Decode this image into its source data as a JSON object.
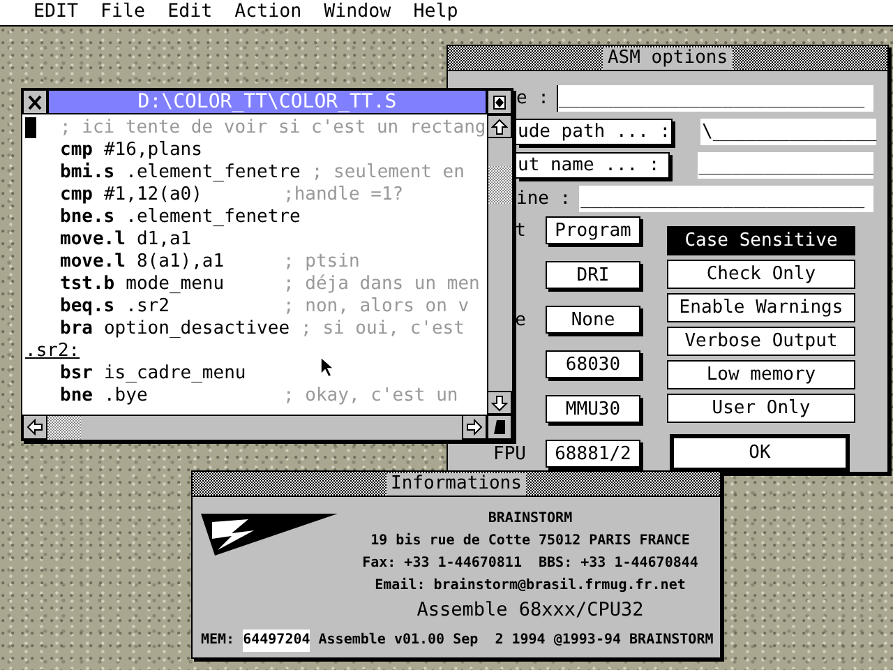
{
  "menu_bar": {
    "items": [
      "EDIT",
      "File",
      "Edit",
      "Action",
      "Window",
      "Help"
    ]
  },
  "asm_options": {
    "title": "ASM options",
    "fields": [
      {
        "kind": "label",
        "label": "e :",
        "value": "____________________________",
        "focused": true
      },
      {
        "kind": "button",
        "label": "ude path ... :",
        "value": "\\_______________",
        "focused": false
      },
      {
        "kind": "button",
        "label": "ut name ... :",
        "value": "________________",
        "focused": false
      },
      {
        "kind": "label",
        "label": "ine :",
        "value": "__________________________",
        "focused": false
      }
    ],
    "choices": [
      {
        "label": "t",
        "value": "Program"
      },
      {
        "value": "DRI"
      },
      {
        "label": "e",
        "value": "None"
      },
      {
        "value": "68030"
      },
      {
        "value": "MMU30"
      },
      {
        "label": "FPU",
        "value": "68881/2"
      }
    ],
    "toggles": [
      {
        "label": "Case Sensitive",
        "selected": true
      },
      {
        "label": "Check Only",
        "selected": false
      },
      {
        "label": "Enable Warnings",
        "selected": false
      },
      {
        "label": "Verbose Output",
        "selected": false
      },
      {
        "label": "Low memory",
        "selected": false
      },
      {
        "label": "User Only",
        "selected": false
      }
    ],
    "ok_button": "OK"
  },
  "editor_window": {
    "title": "D:\\COLOR_TT\\COLOR_TT.S",
    "lines": [
      {
        "kind": "comment",
        "text": "; ici tente de voir si c'est un rectang",
        "cursor": true
      },
      {
        "kind": "instruction",
        "mnemonic": "cmp",
        "operands": "#16,plans",
        "cursor": false
      },
      {
        "kind": "instruction",
        "mnemonic": "bmi.s",
        "operands": ".element_fenetre",
        "comment": "; seulement en",
        "cursor": false
      },
      {
        "kind": "instruction",
        "mnemonic": "cmp",
        "operands": "#1,12(a0)",
        "comment": ";handle =1?",
        "cursor": false
      },
      {
        "kind": "instruction",
        "mnemonic": "bne.s",
        "operands": ".element_fenetre",
        "cursor": false
      },
      {
        "kind": "instruction",
        "mnemonic": "move.l",
        "operands": "d1,a1",
        "cursor": false
      },
      {
        "kind": "instruction",
        "mnemonic": "move.l",
        "operands": "8(a1),a1",
        "comment": "; ptsin",
        "cursor": false
      },
      {
        "kind": "instruction",
        "mnemonic": "tst.b",
        "operands": "mode_menu",
        "comment": "; déja dans un men",
        "cursor": false
      },
      {
        "kind": "instruction",
        "mnemonic": "beq.s",
        "operands": ".sr2",
        "comment": "; non, alors on v",
        "cursor": false
      },
      {
        "kind": "instruction",
        "mnemonic": "bra",
        "operands": "option_desactivee",
        "comment": "; si oui, c'est",
        "cursor": false
      },
      {
        "kind": "label",
        "text": ".sr2:",
        "cursor": false
      },
      {
        "kind": "instruction",
        "mnemonic": "bsr",
        "operands": "is_cadre_menu",
        "cursor": false
      },
      {
        "kind": "instruction",
        "mnemonic": "bne",
        "operands": ".bye",
        "comment": "; okay, c'est un",
        "cursor": false
      }
    ]
  },
  "info_window": {
    "title": "Informations",
    "company": "BRAINSTORM",
    "address": "19 bis rue de Cotte 75012 PARIS FRANCE",
    "contact": "Fax: +33 1-44670811  BBS: +33 1-44670844",
    "email": "Email: brainstorm@brasil.frmug.fr.net",
    "product": "Assemble 68xxx/CPU32",
    "mem_label": "MEM:",
    "mem_value": "64497204",
    "version": "Assemble v01.00 Sep  2 1994 @1993-94 BRAINSTORM"
  }
}
